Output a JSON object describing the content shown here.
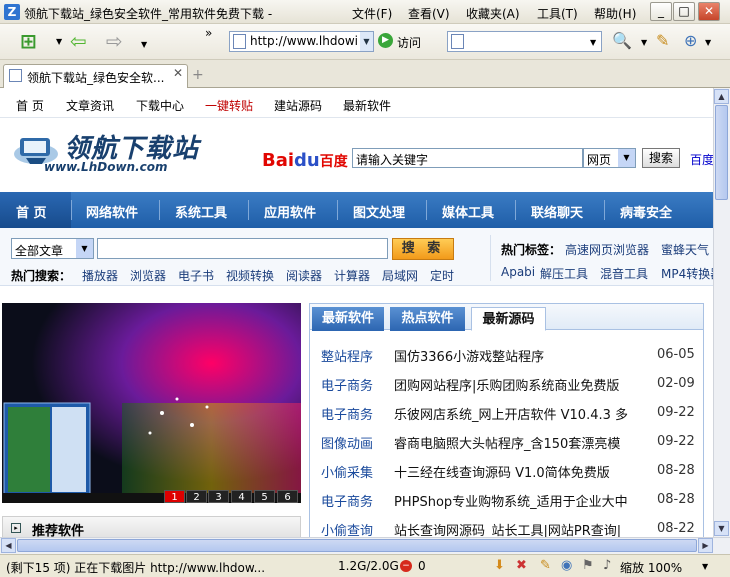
{
  "window": {
    "title": "领航下载站_绿色安全软件_常用软件免费下载 -",
    "menu": [
      "文件(F)",
      "查看(V)",
      "收藏夹(A)",
      "工具(T)",
      "帮助(H)"
    ]
  },
  "toolbar": {
    "address": "http://www.lhdowi",
    "go_label": "访问",
    "search_value": ""
  },
  "tabs": [
    {
      "label": "领航下载站_绿色安全软..."
    }
  ],
  "site": {
    "top_links": [
      "首 页",
      "文章资讯",
      "下载中心",
      "一键转贴",
      "建站源码",
      "最新软件"
    ],
    "logo_cn": "领航下载站",
    "logo_en": "www.LhDown.com",
    "baidu_logo": "Bai百度",
    "baidu_input": "请输入关键字",
    "baidu_select": "网页",
    "baidu_button": "搜索",
    "baidu_link": "百度",
    "nav": [
      "首 页",
      "网络软件",
      "系统工具",
      "应用软件",
      "图文处理",
      "媒体工具",
      "联络聊天",
      "病毒安全"
    ],
    "search": {
      "category": "全部文章",
      "keyword": "",
      "button": "搜 索",
      "hot_label": "热门搜索：",
      "hot_terms": [
        "播放器",
        "浏览器",
        "电子书",
        "视频转换",
        "阅读器",
        "计算器",
        "局域网",
        "定时"
      ],
      "tags_label": "热门标签：",
      "tags_row1": [
        "高速网页浏览器",
        "蜜蜂天气"
      ],
      "tags_row2": [
        "Apabi",
        "解压工具",
        "混音工具",
        "MP4转换器"
      ]
    },
    "slideshow": {
      "pages": [
        "1",
        "2",
        "3",
        "4",
        "5",
        "6"
      ],
      "active": "1"
    },
    "recommend_label": "推荐软件",
    "listbox": {
      "tabs": [
        "最新软件",
        "热点软件",
        "最新源码"
      ],
      "active_tab": "最新源码",
      "rows": [
        {
          "cat": "整站程序",
          "title": "国仿3366小游戏整站程序",
          "date": "06-05"
        },
        {
          "cat": "电子商务",
          "title": "团购网站程序|乐购团购系统商业免费版",
          "date": "02-09"
        },
        {
          "cat": "电子商务",
          "title": "乐彼网店系统_网上开店软件 V10.4.3 多",
          "date": "09-22"
        },
        {
          "cat": "图像动画",
          "title": "睿商电脑照大头帖程序_含150套漂亮模",
          "date": "09-22"
        },
        {
          "cat": "小偷采集",
          "title": "十三经在线查询源码 V1.0简体免费版",
          "date": "08-28"
        },
        {
          "cat": "电子商务",
          "title": "PHPShop专业购物系统_适用于企业大中",
          "date": "08-28"
        },
        {
          "cat": "小偷查询",
          "title": "站长查询网源码_站长工具|网站PR查询|",
          "date": "08-22"
        }
      ]
    }
  },
  "status": {
    "text": "(剩下15 项) 正在下载图片 http://www.lhdow...",
    "size": "1.2G/2.0G",
    "count": "0",
    "zoom": "缩放 100%"
  },
  "colors": {
    "nav_blue": "#1f5ea8",
    "accent_orange": "#f29a1a",
    "hot_red": "#c00000"
  }
}
